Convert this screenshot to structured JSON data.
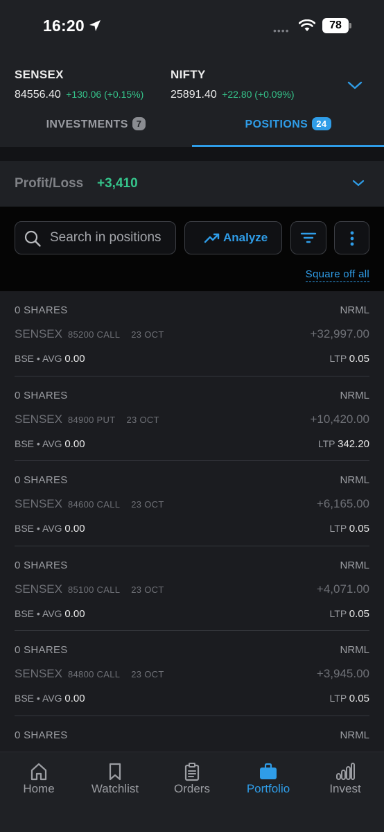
{
  "status_bar": {
    "time": "16:20",
    "battery": "78"
  },
  "indices": [
    {
      "name": "SENSEX",
      "price": "84556.40",
      "change": "+130.06 (+0.15%)"
    },
    {
      "name": "NIFTY",
      "price": "25891.40",
      "change": "+22.80 (+0.09%)"
    }
  ],
  "tabs": {
    "investments": {
      "label": "INVESTMENTS",
      "count": "7"
    },
    "positions": {
      "label": "POSITIONS",
      "count": "24"
    }
  },
  "profit_loss": {
    "label": "Profit/Loss",
    "value": "+3,410"
  },
  "toolbar": {
    "search_placeholder": "Search in positions",
    "analyze_label": "Analyze",
    "square_off_label": "Square off all"
  },
  "positions": [
    {
      "shares": "0 SHARES",
      "product": "NRML",
      "symbol": "SENSEX",
      "strike": "85200 CALL",
      "expiry": "23 OCT",
      "pnl": "+32,997.00",
      "exchange": "BSE",
      "avg_label": "AVG",
      "avg": "0.00",
      "ltp_label": "LTP",
      "ltp": "0.05"
    },
    {
      "shares": "0 SHARES",
      "product": "NRML",
      "symbol": "SENSEX",
      "strike": "84900 PUT",
      "expiry": "23 OCT",
      "pnl": "+10,420.00",
      "exchange": "BSE",
      "avg_label": "AVG",
      "avg": "0.00",
      "ltp_label": "LTP",
      "ltp": "342.20"
    },
    {
      "shares": "0 SHARES",
      "product": "NRML",
      "symbol": "SENSEX",
      "strike": "84600 CALL",
      "expiry": "23 OCT",
      "pnl": "+6,165.00",
      "exchange": "BSE",
      "avg_label": "AVG",
      "avg": "0.00",
      "ltp_label": "LTP",
      "ltp": "0.05"
    },
    {
      "shares": "0 SHARES",
      "product": "NRML",
      "symbol": "SENSEX",
      "strike": "85100 CALL",
      "expiry": "23 OCT",
      "pnl": "+4,071.00",
      "exchange": "BSE",
      "avg_label": "AVG",
      "avg": "0.00",
      "ltp_label": "LTP",
      "ltp": "0.05"
    },
    {
      "shares": "0 SHARES",
      "product": "NRML",
      "symbol": "SENSEX",
      "strike": "84800 CALL",
      "expiry": "23 OCT",
      "pnl": "+3,945.00",
      "exchange": "BSE",
      "avg_label": "AVG",
      "avg": "0.00",
      "ltp_label": "LTP",
      "ltp": "0.05"
    },
    {
      "shares": "0 SHARES",
      "product": "NRML"
    }
  ],
  "bottom_nav": [
    {
      "label": "Home",
      "icon": "home-icon"
    },
    {
      "label": "Watchlist",
      "icon": "bookmark-icon"
    },
    {
      "label": "Orders",
      "icon": "clipboard-icon"
    },
    {
      "label": "Portfolio",
      "icon": "briefcase-icon",
      "active": true
    },
    {
      "label": "Invest",
      "icon": "bar-chart-icon"
    }
  ],
  "colors": {
    "accent": "#2f9de8",
    "profit": "#35c48b",
    "background": "#1b1c20"
  }
}
